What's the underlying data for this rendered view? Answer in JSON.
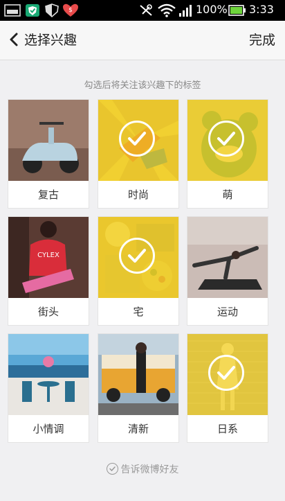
{
  "status_bar": {
    "battery_percent": "100%",
    "time": "3:33",
    "icons": [
      "notification-icon",
      "shield-icon",
      "security-icon",
      "sale-icon",
      "mute-icon",
      "wifi-icon",
      "signal-icon",
      "battery-icon"
    ]
  },
  "nav": {
    "back_icon": "chevron-left-icon",
    "title": "选择兴趣",
    "done_label": "完成"
  },
  "hint": "勾选后将关注该兴趣下的标签",
  "interests": [
    {
      "label": "复古",
      "selected": false
    },
    {
      "label": "时尚",
      "selected": true
    },
    {
      "label": "萌",
      "selected": true
    },
    {
      "label": "街头",
      "selected": false
    },
    {
      "label": "宅",
      "selected": true
    },
    {
      "label": "运动",
      "selected": false
    },
    {
      "label": "小情调",
      "selected": false
    },
    {
      "label": "清新",
      "selected": false
    },
    {
      "label": "日系",
      "selected": true
    }
  ],
  "share": {
    "icon": "check-circle-icon",
    "label": "告诉微博好友",
    "checked": false
  },
  "colors": {
    "selected_overlay": "#f6d628",
    "background": "#f0f0f2"
  }
}
